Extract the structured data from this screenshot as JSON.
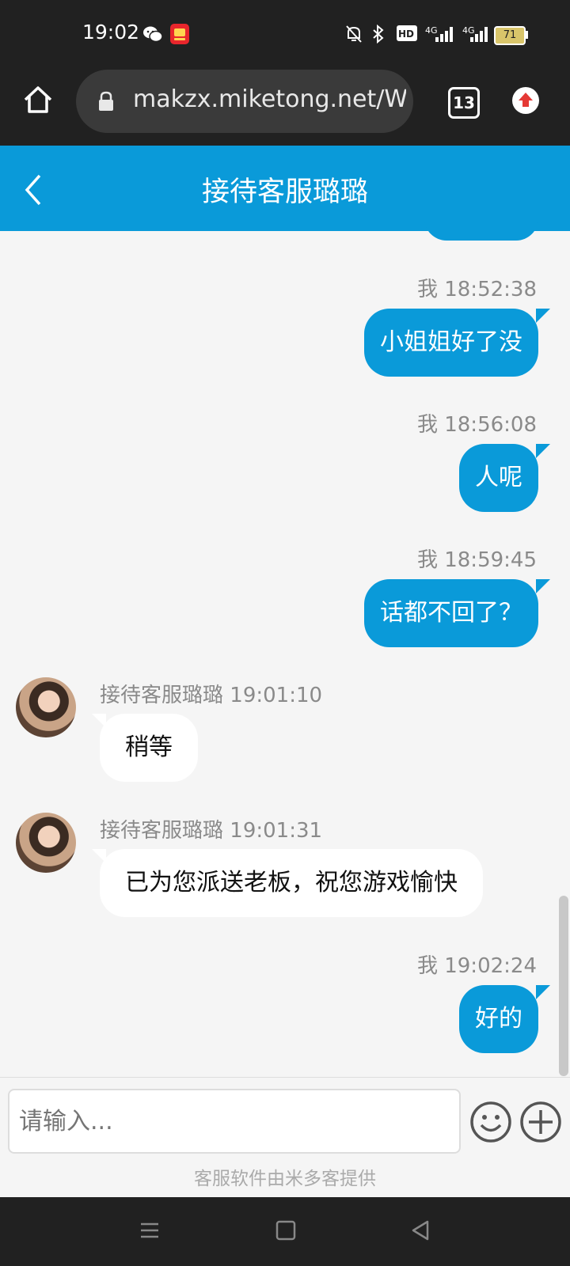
{
  "status_bar": {
    "time": "19:02",
    "network_1": "4G",
    "network_2": "4G",
    "battery": "71"
  },
  "browser": {
    "url": "makzx.miketong.net/We",
    "tab_count": "13"
  },
  "chat": {
    "title": "接待客服璐璐"
  },
  "messages": [
    {
      "sender": "我",
      "time": "18:52:38",
      "text": "小姐姐好了没",
      "direction": "out"
    },
    {
      "sender": "我",
      "time": "18:56:08",
      "text": "人呢",
      "direction": "out"
    },
    {
      "sender": "我",
      "time": "18:59:45",
      "text": "话都不回了？",
      "direction": "out"
    },
    {
      "sender": "接待客服璐璐",
      "time": "19:01:10",
      "text": "稍等",
      "direction": "in"
    },
    {
      "sender": "接待客服璐璐",
      "time": "19:01:31",
      "text": "已为您派送老板，祝您游戏愉快",
      "direction": "in"
    },
    {
      "sender": "我",
      "time": "19:02:24",
      "text": "好的",
      "direction": "out"
    }
  ],
  "input": {
    "placeholder": "请输入..."
  },
  "footer": {
    "text": "客服软件由米多客提供"
  },
  "colors": {
    "accent": "#0a9ad9",
    "upload": "#e53935"
  }
}
